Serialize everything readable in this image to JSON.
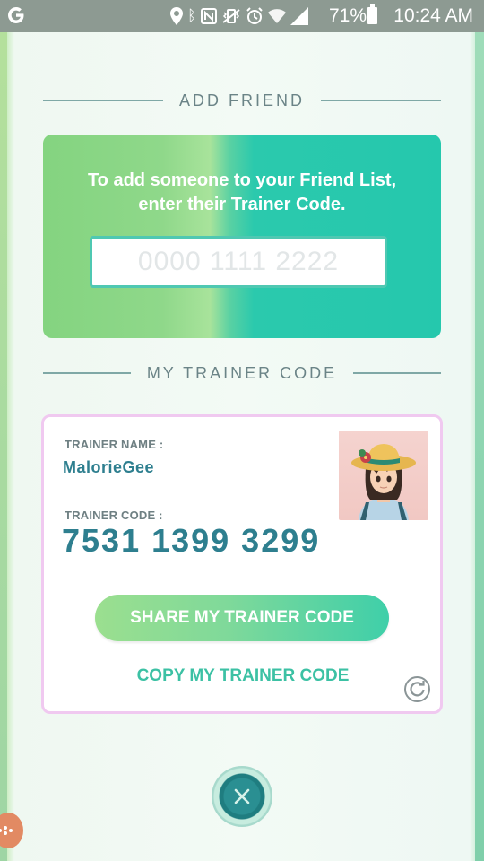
{
  "status_bar": {
    "app_icon": "google-g-icon",
    "icons": [
      "location-icon",
      "bluetooth-icon",
      "nfc-icon",
      "vibrate-icon",
      "alarm-icon",
      "wifi-icon",
      "signal-icon"
    ],
    "battery": "71%",
    "time": "10:24 AM"
  },
  "add_friend": {
    "title": "ADD FRIEND",
    "instructions": "To add someone to your Friend List, enter their Trainer Code.",
    "input_placeholder": "0000 1111 2222",
    "input_value": ""
  },
  "my_trainer_code": {
    "title": "MY TRAINER CODE",
    "name_label": "TRAINER NAME :",
    "name": "MalorieGee",
    "code_label": "TRAINER CODE :",
    "code": "7531 1399 3299",
    "share_label": "SHARE MY TRAINER CODE",
    "copy_label": "COPY MY TRAINER CODE",
    "avatar": "trainer-avatar",
    "refresh_icon": "refresh-icon"
  },
  "close_icon": "close-icon",
  "colors": {
    "accent_teal": "#2e7f8f",
    "accent_green": "#3cc1a4",
    "card_border": "#f0c9f0"
  }
}
